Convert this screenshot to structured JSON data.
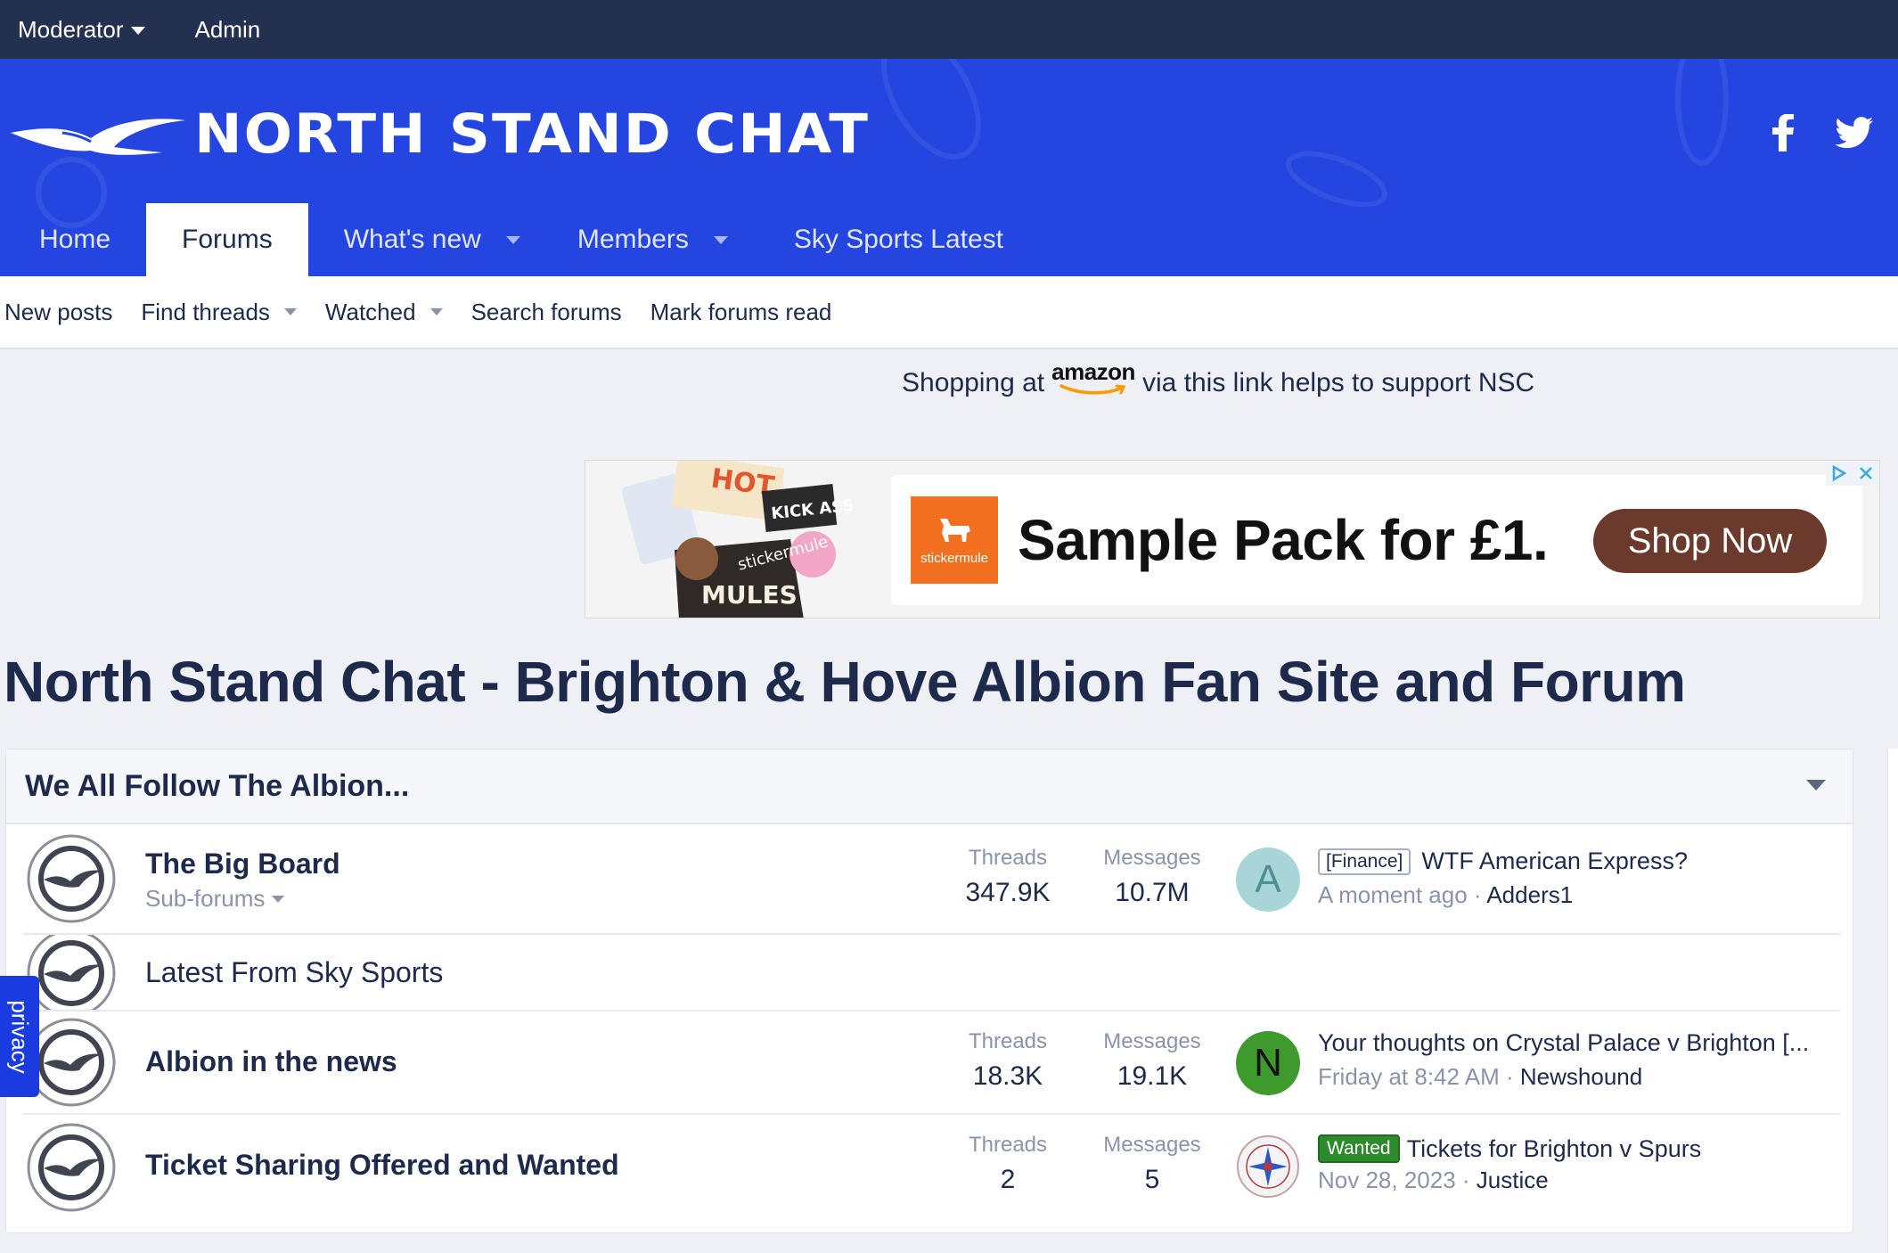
{
  "staff_bar": {
    "moderator": "Moderator",
    "admin": "Admin"
  },
  "header": {
    "logo_text": "NORTH STAND CHAT",
    "social": [
      "facebook-icon",
      "twitter-icon"
    ]
  },
  "nav": {
    "tabs": [
      {
        "label": "Home",
        "active": false,
        "dropdown": false
      },
      {
        "label": "Forums",
        "active": true,
        "dropdown": false
      },
      {
        "label": "What's new",
        "active": false,
        "dropdown": true
      },
      {
        "label": "Members",
        "active": false,
        "dropdown": true
      },
      {
        "label": "Sky Sports Latest",
        "active": false,
        "dropdown": false
      }
    ]
  },
  "subnav": {
    "items": [
      {
        "label": "New posts",
        "dropdown": false
      },
      {
        "label": "Find threads",
        "dropdown": true
      },
      {
        "label": "Watched",
        "dropdown": true
      },
      {
        "label": "Search forums",
        "dropdown": false
      },
      {
        "label": "Mark forums read",
        "dropdown": false
      }
    ]
  },
  "amazon": {
    "before": "Shopping at",
    "logo": "amazon",
    "after": "via this link helps to support NSC"
  },
  "ad": {
    "brand": "stickermule",
    "headline": "Sample Pack for £1.",
    "button": "Shop Now"
  },
  "page": {
    "title": "North Stand Chat - Brighton & Hove Albion Fan Site and Forum"
  },
  "category": {
    "title": "We All Follow The Albion...",
    "nodes": [
      {
        "title": "The Big Board",
        "sub": "Sub-forums",
        "threads_label": "Threads",
        "threads": "347.9K",
        "messages_label": "Messages",
        "messages": "10.7M",
        "avatar_letter": "A",
        "prefix": "[Finance]",
        "last_title": "WTF American Express?",
        "last_time": "A moment ago",
        "last_user": "Adders1"
      },
      {
        "title": "Latest From Sky Sports"
      },
      {
        "title": "Albion in the news",
        "threads_label": "Threads",
        "threads": "18.3K",
        "messages_label": "Messages",
        "messages": "19.1K",
        "avatar_letter": "N",
        "last_title": "Your thoughts on Crystal Palace v Brighton [...",
        "last_time": "Friday at 8:42 AM",
        "last_user": "Newshound"
      },
      {
        "title": "Ticket Sharing Offered and Wanted",
        "threads_label": "Threads",
        "threads": "2",
        "messages_label": "Messages",
        "messages": "5",
        "prefix": "Wanted",
        "last_title": "Tickets for Brighton v Spurs",
        "last_time": "Nov 28, 2023",
        "last_user": "Justice"
      }
    ]
  },
  "privacy": "privacy",
  "separator": "·",
  "colors": {
    "staff_bar": "#23304f",
    "header_blue": "#2545e0",
    "text_dark": "#1d2a4b",
    "muted": "#8a93a8",
    "wanted_green": "#2d8a2d",
    "ad_button": "#6b3a2c",
    "stickermule_orange": "#f37021"
  }
}
